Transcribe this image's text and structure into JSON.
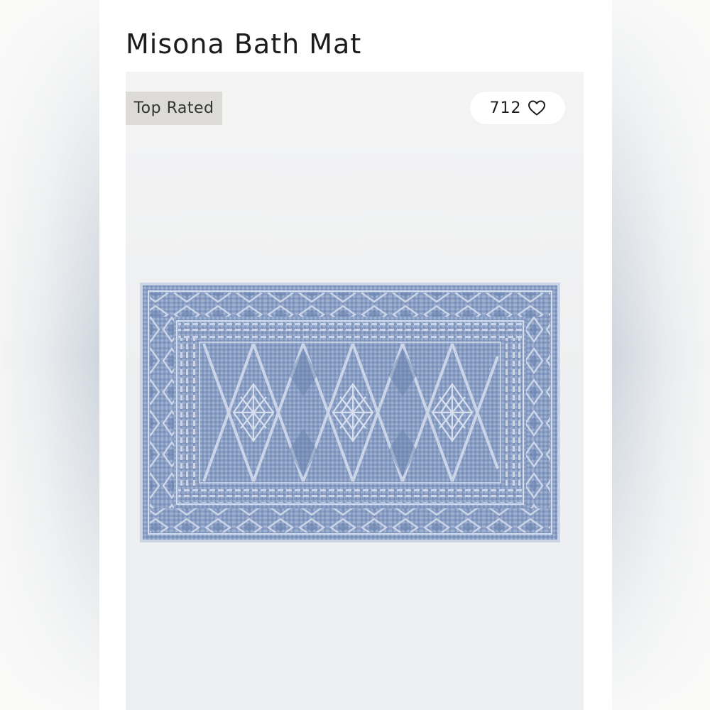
{
  "product": {
    "title": "Misona Bath Mat",
    "badge": "Top Rated",
    "likes": "712",
    "like_icon": "heart-outline-icon"
  },
  "image": {
    "subject": "bath-mat",
    "mat_color": "#7f95bd",
    "mat_light": "#b9c6dc",
    "mat_dark": "#5e78a6"
  }
}
